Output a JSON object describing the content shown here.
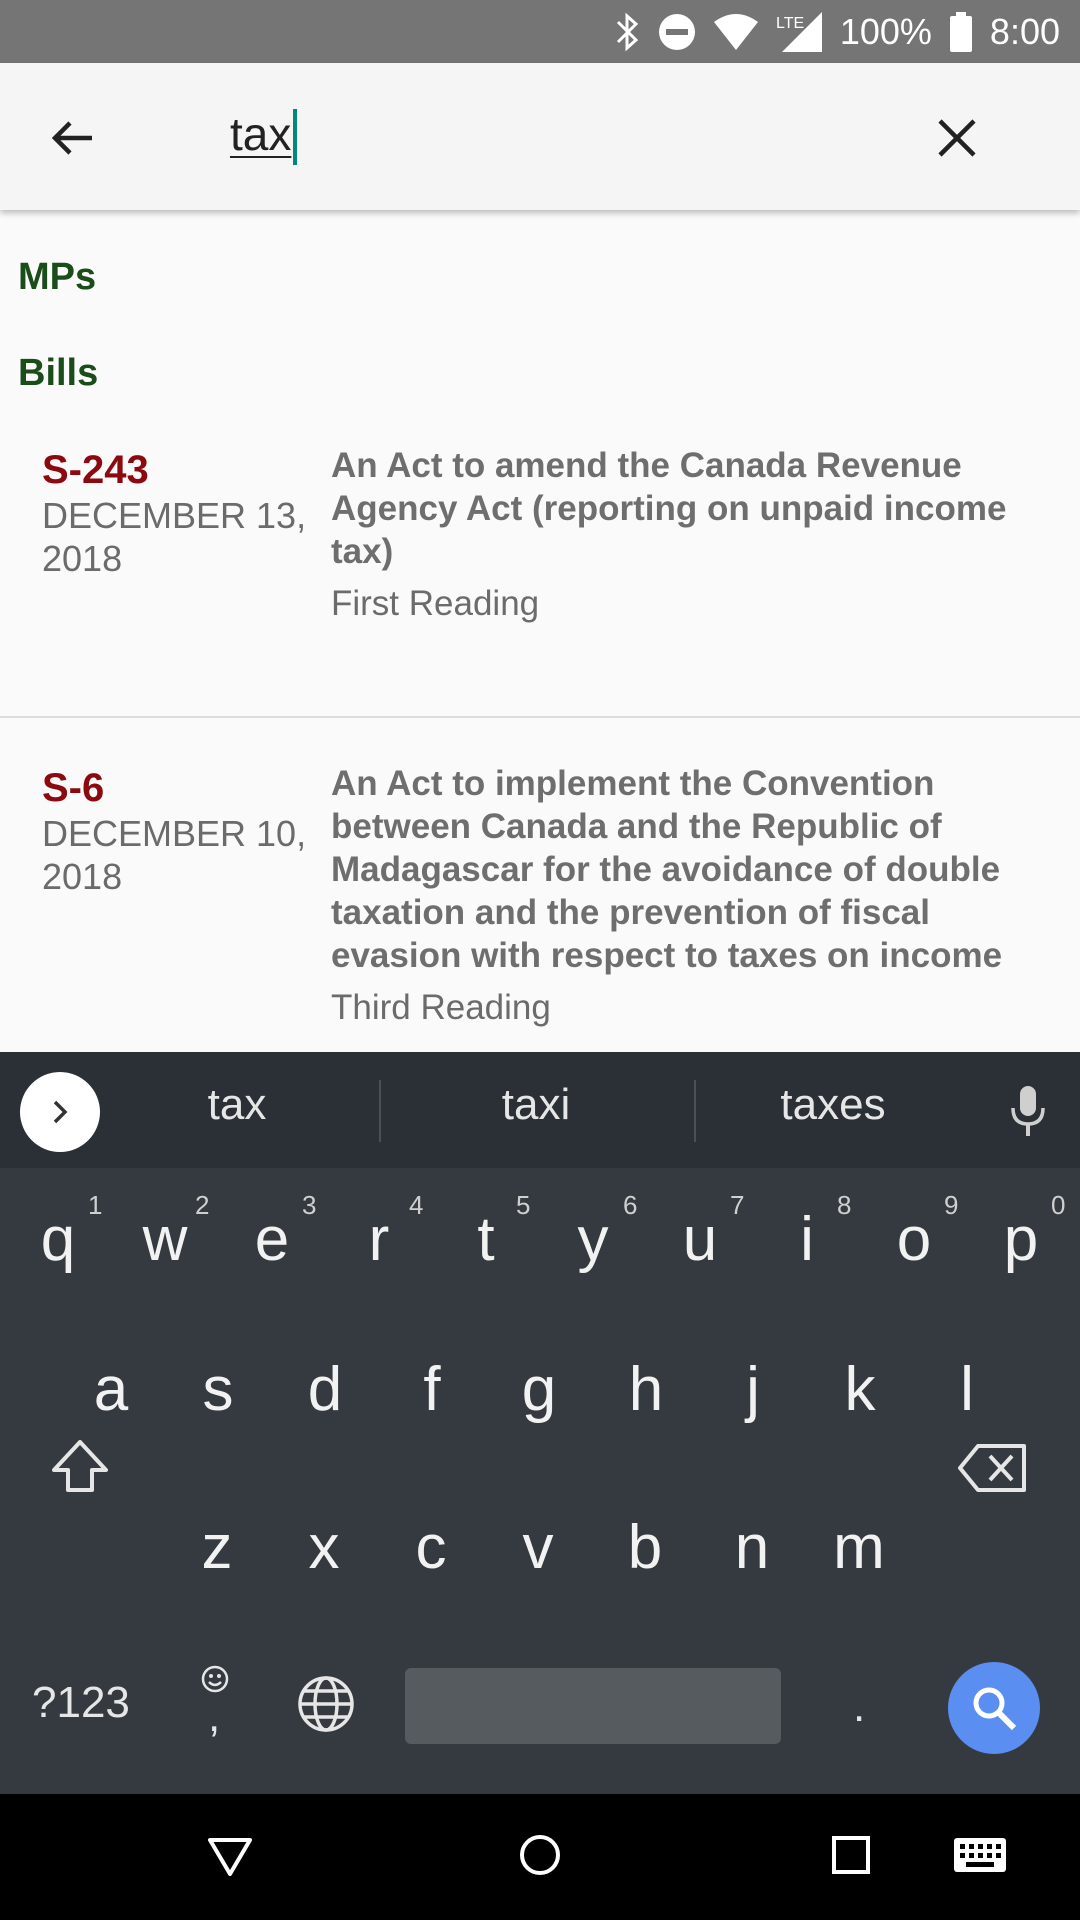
{
  "status_bar": {
    "battery": "100%",
    "time": "8:00",
    "network": "LTE",
    "icons": [
      "bluetooth-icon",
      "do-not-disturb-icon",
      "wifi-icon",
      "lte-signal-icon",
      "battery-icon"
    ]
  },
  "search": {
    "query": "tax",
    "back_icon": "arrow-left-icon",
    "clear_icon": "close-icon"
  },
  "sections": {
    "mps": "MPs",
    "bills": "Bills"
  },
  "bills": [
    {
      "number": "S-243",
      "date": "DECEMBER 13, 2018",
      "title": "An Act to amend the Canada Revenue Agency Act (reporting on unpaid income tax)",
      "status": "First Reading"
    },
    {
      "number": "S-6",
      "date": "DECEMBER 10, 2018",
      "title": "An Act to implement the Convention between Canada and the Republic of Madagascar for the avoidance of double taxation and the prevention of fiscal evasion with respect to taxes on income",
      "status": "Third Reading"
    }
  ],
  "keyboard": {
    "suggestions": [
      "tax",
      "taxi",
      "taxes"
    ],
    "row1": [
      "q",
      "w",
      "e",
      "r",
      "t",
      "y",
      "u",
      "i",
      "o",
      "p"
    ],
    "row1_hints": [
      "1",
      "2",
      "3",
      "4",
      "5",
      "6",
      "7",
      "8",
      "9",
      "0"
    ],
    "row2": [
      "a",
      "s",
      "d",
      "f",
      "g",
      "h",
      "j",
      "k",
      "l"
    ],
    "row3": [
      "z",
      "x",
      "c",
      "v",
      "b",
      "n",
      "m"
    ],
    "symbols_label": "?123",
    "comma": ",",
    "period": "."
  },
  "colors": {
    "section_header": "#1b4d1b",
    "bill_number": "#8b0a10",
    "keyboard_bg": "#343a3f",
    "search_key": "#5a8ef0",
    "caret": "#00897b"
  }
}
